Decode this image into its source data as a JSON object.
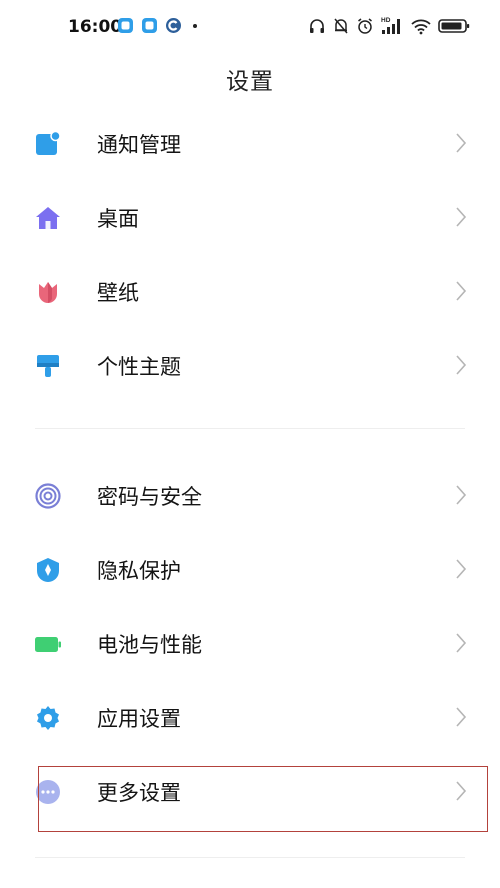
{
  "status_bar": {
    "time": "16:00",
    "icons": [
      "headphones-icon",
      "mute-bell-icon",
      "alarm-icon",
      "hd-signal-icon",
      "wifi-icon",
      "battery-icon"
    ],
    "hd_label": "HD"
  },
  "page": {
    "title": "设置"
  },
  "settings": {
    "items": [
      {
        "label": "通知管理",
        "icon": "notification-icon",
        "color": "#2f9ee8"
      },
      {
        "label": "桌面",
        "icon": "home-icon",
        "color": "#7b6ff0"
      },
      {
        "label": "壁纸",
        "icon": "tulip-icon",
        "color": "#e9667a"
      },
      {
        "label": "个性主题",
        "icon": "paint-brush-icon",
        "color": "#2f9ee8"
      },
      {
        "label": "密码与安全",
        "icon": "fingerprint-icon",
        "color": "#7a7fd6"
      },
      {
        "label": "隐私保护",
        "icon": "privacy-shield-icon",
        "color": "#2f9ee8"
      },
      {
        "label": "电池与性能",
        "icon": "battery-performance-icon",
        "color": "#3fcf73"
      },
      {
        "label": "应用设置",
        "icon": "gear-icon",
        "color": "#2f9ee8"
      },
      {
        "label": "更多设置",
        "icon": "more-dots-icon",
        "color": "#a9b3ee"
      }
    ]
  }
}
